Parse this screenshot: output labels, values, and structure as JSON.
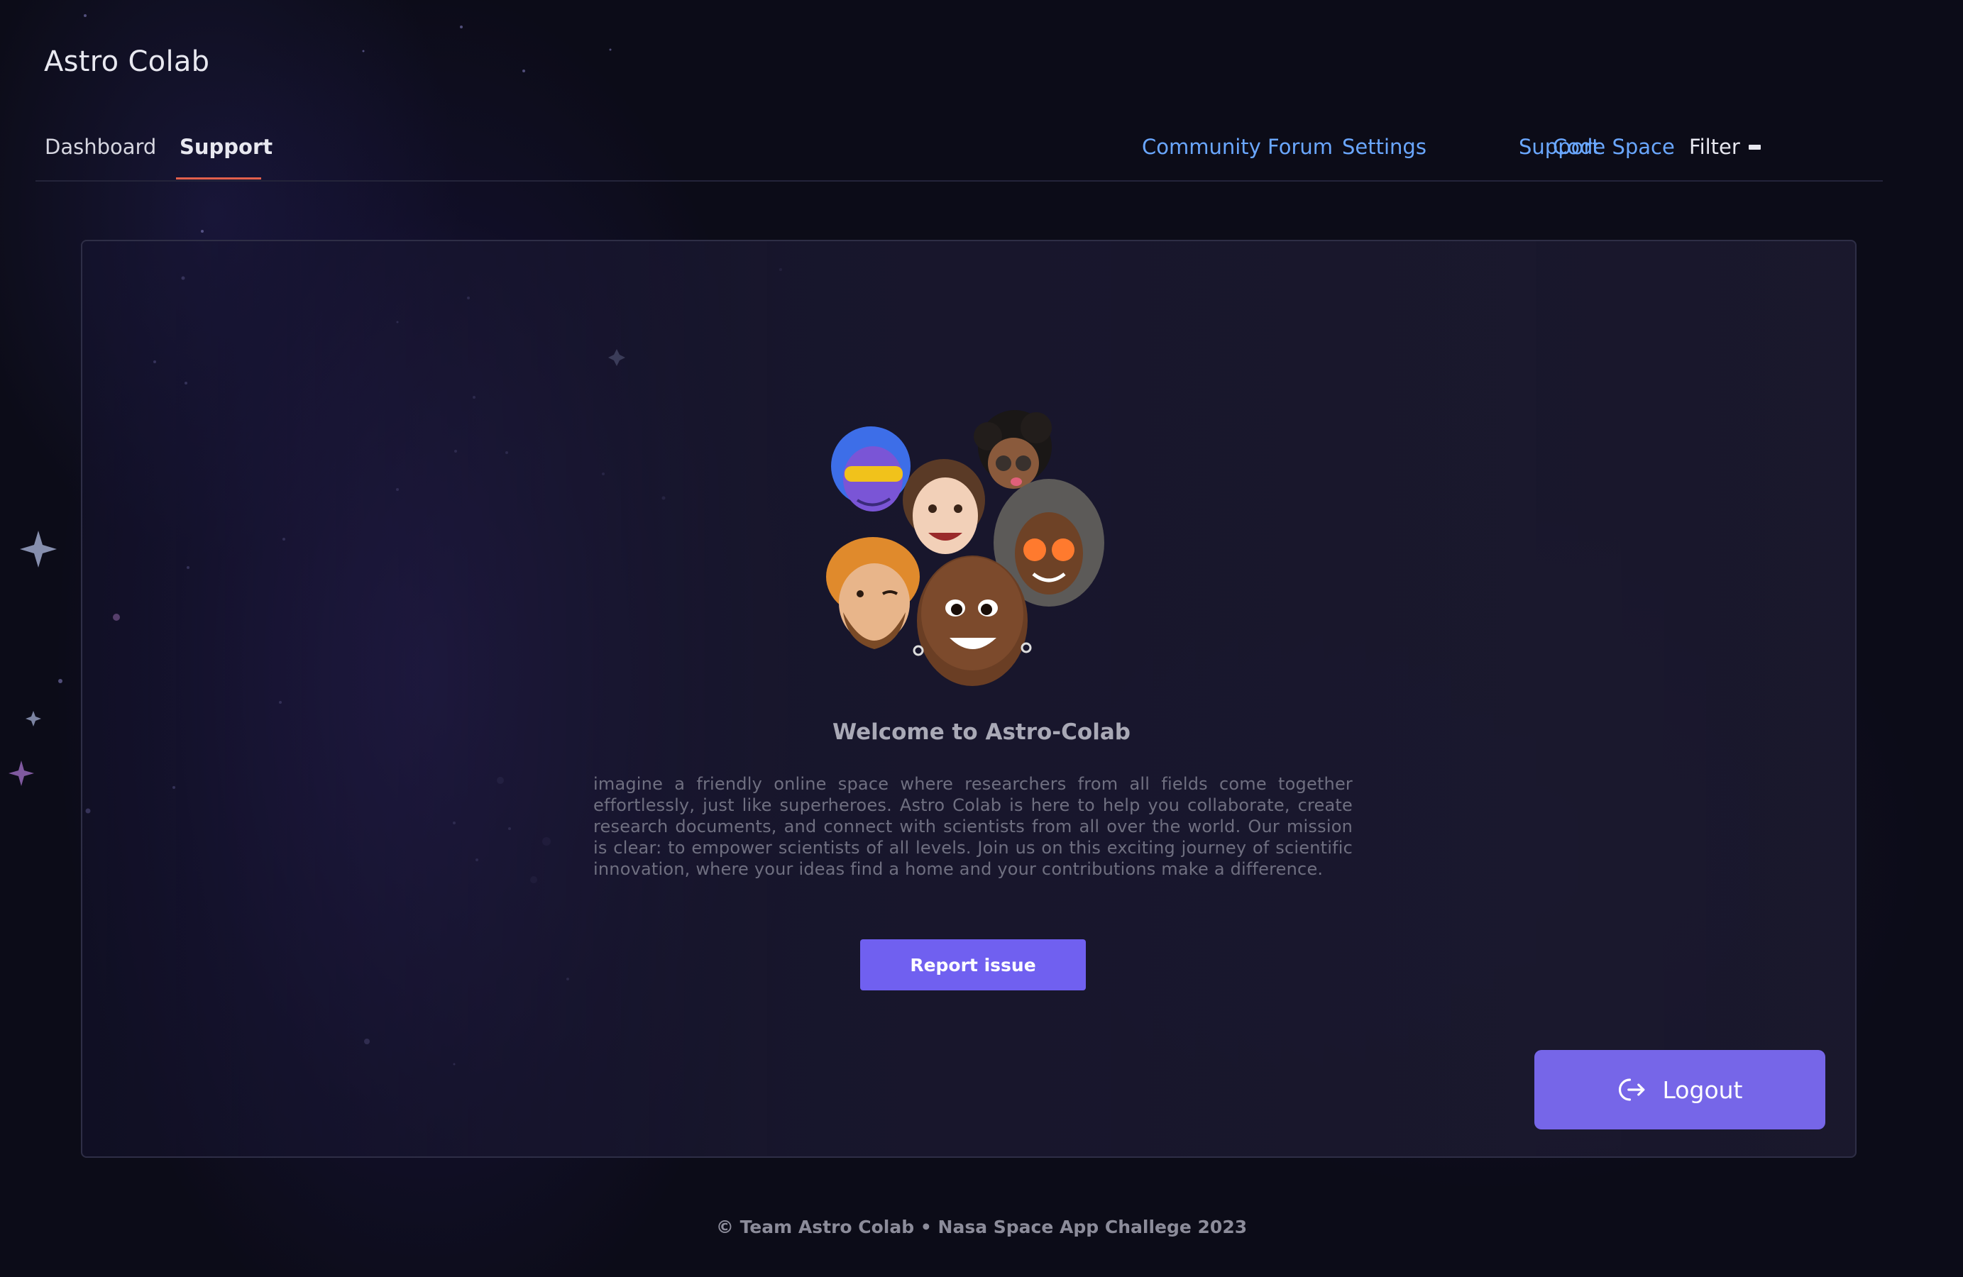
{
  "app": {
    "brand": "Astro Colab"
  },
  "nav": {
    "tabs": [
      {
        "label": "Dashboard",
        "active": false
      },
      {
        "label": "Support",
        "active": true
      }
    ],
    "links": [
      {
        "label": "Community Forum"
      },
      {
        "label": "Settings"
      },
      {
        "label": "Support"
      },
      {
        "label": "Code Space"
      }
    ],
    "filter_label": "Filter"
  },
  "main": {
    "illustration": "group-of-memoji-avatars",
    "welcome_title": "Welcome to Astro-Colab",
    "description": "imagine a friendly online space where researchers from all fields come together effortlessly, just like superheroes. Astro Colab is here to help you collaborate, create research documents, and connect with scientists from all over the world. Our mission is clear: to empower scientists of all levels. Join us on this exciting journey of scientific innovation, where your ideas find a home and your contributions make a difference.",
    "report_button": "Report issue",
    "logout_button": "Logout"
  },
  "footer": {
    "text": "© Team Astro Colab • Nasa Space App Challege 2023"
  },
  "colors": {
    "accent": "#7060f0",
    "link": "#6aa7ff",
    "active_tab_underline": "#e2604c",
    "background": "#0c0c18"
  }
}
